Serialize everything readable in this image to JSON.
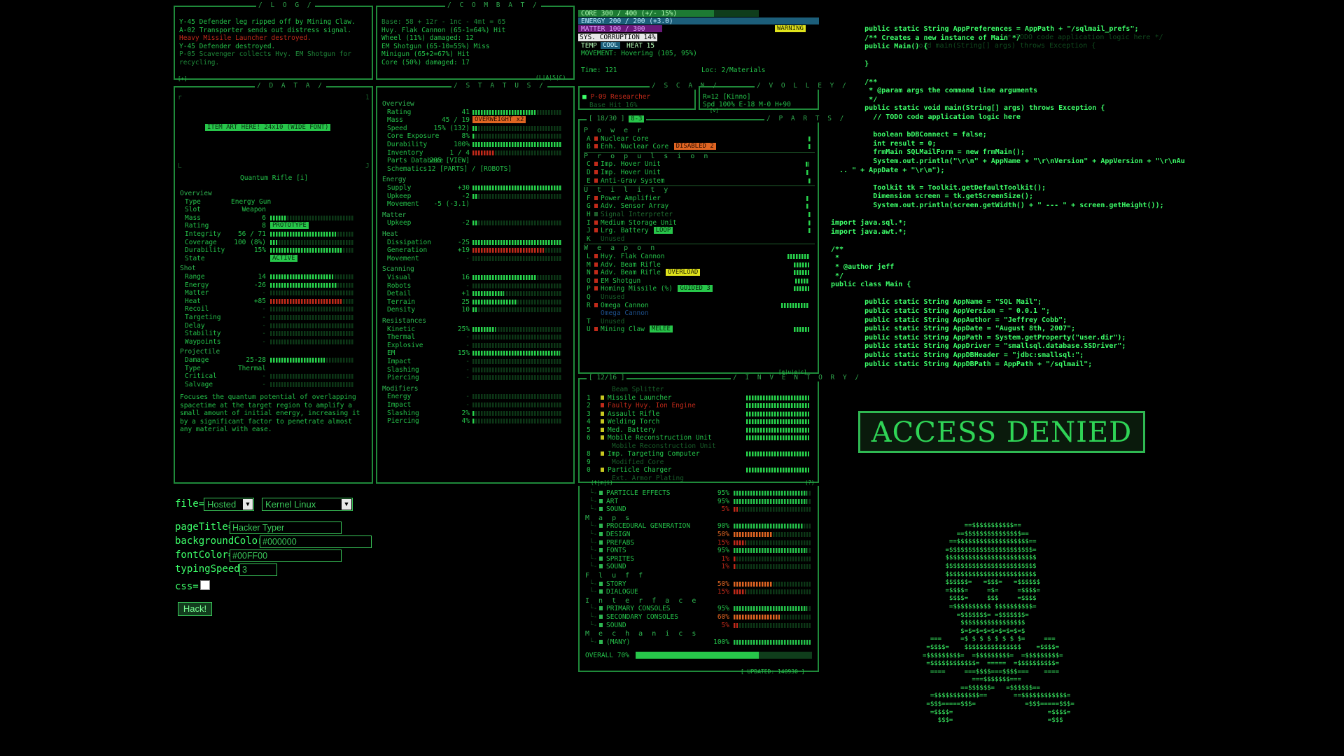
{
  "colors": {
    "accent": "#3dff6a",
    "border": "#1f8a3a",
    "warn": "#e0e31c",
    "danger": "#c22a1a",
    "orange": "#e06522"
  },
  "log": {
    "title": "/ L O G /",
    "lines": [
      "Y-45 Defender leg ripped off by Mining Claw.",
      "A-02 Transporter sends out distress signal.",
      "Heavy Missile Launcher destroyed.",
      "Y-45 Defender destroyed.",
      "P-05 Scavenger collects Hvy. EM Shotgun for",
      "  recycling."
    ],
    "footer_left": "[+]",
    "footer_right": "(L|A|S|C)"
  },
  "combat": {
    "title": "/ C O M B A T /",
    "lines": [
      "Base: 58 + 12r - 1nc - 4mt = 65",
      "Hvy. Flak Cannon (65-1=64%) Hit",
      "  Wheel (11%) damaged: 12",
      "EM Shotgun (65-10=55%) Miss",
      "Minigun (65+2=67%) Hit",
      "  Core (50%) damaged: 17"
    ]
  },
  "vitals": {
    "core": "CORE   300 / 400  (+/- 15%)",
    "energy": "ENERGY 200 / 200  (+3.0)",
    "matter": "MATTER 100 / 300",
    "warning": "WARNING",
    "sys": "SYS. CORRUPTION 14%",
    "temp_label": "TEMP",
    "temp_state": "COOL",
    "heat": "HEAT 15",
    "movement": "MOVEMENT: Hovering (105, 95%)",
    "time": "Time: 121",
    "loc": "Loc: 2/Materials"
  },
  "data_panel": {
    "title": "/ D A T A /",
    "art_placeholder": "ITEM ART HERE! 24x10 (WIDE FONT)",
    "item_name": "Quantum Rifle [i]",
    "sections": [
      {
        "header": "Overview",
        "rows": [
          {
            "label": "Type",
            "value": "Energy Gun"
          },
          {
            "label": "Slot",
            "value": "Weapon"
          },
          {
            "label": "Mass",
            "value": "6",
            "bar": 0.2
          },
          {
            "label": "Rating",
            "value": "8",
            "badge": "PROTOTYPE"
          },
          {
            "label": "Integrity",
            "value": "56 / 71",
            "bar": 0.78
          },
          {
            "label": "Coverage",
            "value": "100 (8%)",
            "bar": 0.08
          },
          {
            "label": "Durability",
            "value": "15%",
            "bar": 0.85
          },
          {
            "label": "State",
            "badge": "ACTIVE"
          }
        ]
      },
      {
        "header": "Shot",
        "rows": [
          {
            "label": "Range",
            "value": "14",
            "bar": 0.75
          },
          {
            "label": "Energy",
            "value": "-26",
            "bar": 0.8
          },
          {
            "label": "Matter",
            "value": "-"
          },
          {
            "label": "Heat",
            "value": "+85",
            "bar": 0.85,
            "red": true
          },
          {
            "label": "Recoil",
            "value": "-"
          },
          {
            "label": "Targeting",
            "value": "-"
          },
          {
            "label": "Delay",
            "value": "-"
          },
          {
            "label": "Stability",
            "value": "-"
          },
          {
            "label": "Waypoints",
            "value": "-"
          }
        ]
      },
      {
        "header": "Projectile",
        "rows": [
          {
            "label": "Damage",
            "value": "25-28",
            "bar": 0.65
          },
          {
            "label": "Type",
            "value": "Thermal"
          },
          {
            "label": "Critical",
            "value": "-"
          },
          {
            "label": "Salvage",
            "value": "-"
          }
        ]
      }
    ],
    "description": [
      "Focuses the quantum potential of overlapping",
      "spacetime at the target region to amplify a",
      "small amount of initial energy, increasing it",
      "by a significant factor to penetrate almost",
      "any material with ease."
    ]
  },
  "status_panel": {
    "title": "/ S T A T U S /",
    "sections": [
      {
        "header": "Overview",
        "rows": [
          {
            "label": "Rating",
            "value": "41",
            "bar": 0.7
          },
          {
            "label": "Mass",
            "value": "45 / 19",
            "badge": "OVERWEIGHT x2"
          },
          {
            "label": "Speed",
            "value": "15% (132)",
            "bar": 0.05
          },
          {
            "label": "Core Exposure",
            "value": "8%",
            "bar": 0.03
          },
          {
            "label": "Durability",
            "value": "100%",
            "bar": 1.0
          },
          {
            "label": "Inventory",
            "value": "1 / 4",
            "bar": 0.25,
            "red": true
          },
          {
            "label": "Parts Database",
            "value": "295 [VIEW]"
          },
          {
            "label": "Schematics",
            "value": "12 [PARTS] / [ROBOTS]"
          }
        ]
      },
      {
        "header": "Energy",
        "rows": [
          {
            "label": "Supply",
            "value": "+30",
            "bar": 1.0
          },
          {
            "label": "Upkeep",
            "value": "-2",
            "bar": 0.06
          },
          {
            "label": "Movement",
            "value": "-5 (-3.1)"
          }
        ]
      },
      {
        "header": "Matter",
        "rows": [
          {
            "label": "Upkeep",
            "value": "-2",
            "bar": 0.06
          }
        ]
      },
      {
        "header": "Heat",
        "rows": [
          {
            "label": "Dissipation",
            "value": "-25",
            "bar": 1.0
          },
          {
            "label": "Generation",
            "value": "+19",
            "bar": 0.8,
            "red": true
          },
          {
            "label": "Movement",
            "value": "-"
          }
        ]
      },
      {
        "header": "Scanning",
        "rows": [
          {
            "label": "Visual",
            "value": "16",
            "bar": 0.72
          },
          {
            "label": "Robots",
            "value": "-"
          },
          {
            "label": "Detail",
            "value": "+1",
            "bar": 0.35
          },
          {
            "label": "Terrain",
            "value": "25",
            "bar": 0.5
          },
          {
            "label": "Density",
            "value": "10",
            "bar": 0.05
          }
        ]
      },
      {
        "header": "Resistances",
        "rows": [
          {
            "label": "Kinetic",
            "value": "25%",
            "bar": 0.26
          },
          {
            "label": "Thermal",
            "value": "-"
          },
          {
            "label": "Explosive",
            "value": "-"
          },
          {
            "label": "EM",
            "value": "15%",
            "bar": 0.98
          },
          {
            "label": "Impact",
            "value": "-"
          },
          {
            "label": "Slashing",
            "value": "-"
          },
          {
            "label": "Piercing",
            "value": "-"
          }
        ]
      },
      {
        "header": "Modifiers",
        "rows": [
          {
            "label": "Energy",
            "value": "-"
          },
          {
            "label": "Impact",
            "value": "-"
          },
          {
            "label": "Slashing",
            "value": "2%",
            "bar": 0.02
          },
          {
            "label": "Piercing",
            "value": "4%",
            "bar": 0.03
          }
        ]
      }
    ]
  },
  "scan": {
    "title": "/ S C A N /",
    "line1": "P-09 Researcher",
    "line2": "Base Hit 16%"
  },
  "volley": {
    "title": "/ V O L L E Y /",
    "line1": "R=12 [Kinno]",
    "line2": "Spd 100% E-18 M-0 H+90",
    "footer": "[v]"
  },
  "parts": {
    "title": "/ P A R T S /",
    "counter": "[ 18/30 ]",
    "counter_badge": "8-3",
    "groups": [
      {
        "header": "P o w e r",
        "items": [
          {
            "key": "A",
            "name": "Nuclear Core",
            "strength": 0.01
          },
          {
            "key": "B",
            "name": "Enh. Nuclear Core",
            "badge": "DISABLED 2",
            "badge_color": "orange",
            "strength": 0.01
          }
        ]
      },
      {
        "header": "P r o p u l s i o n",
        "items": [
          {
            "key": "C",
            "name": "Imp. Hover Unit",
            "strength": 0.06
          },
          {
            "key": "D",
            "name": "Imp. Hover Unit",
            "strength": 0.04
          },
          {
            "key": "E",
            "name": "Anti-Grav System",
            "strength": 0.01
          }
        ]
      },
      {
        "header": "U t i l i t y",
        "items": [
          {
            "key": "F",
            "name": "Power Amplifier",
            "strength": 0.04
          },
          {
            "key": "G",
            "name": "Adv. Sensor Array",
            "strength": 0.04
          },
          {
            "key": "H",
            "name": "Signal Interpreter",
            "dim": true,
            "strength": 0.01
          },
          {
            "key": "I",
            "name": "Medium Storage Unit",
            "strength": 0.01
          },
          {
            "key": "J",
            "name": "Lrg. Battery",
            "badge": "LOOP",
            "badge_color": "lime",
            "strength": 0.01
          },
          {
            "key": "K",
            "name": "Unused",
            "dim": true,
            "unused": true
          }
        ]
      },
      {
        "header": "W e a p o n",
        "items": [
          {
            "key": "L",
            "name": "Hvy. Flak Cannon",
            "strength": 0.35
          },
          {
            "key": "M",
            "name": "Adv. Beam Rifle",
            "strength": 0.25
          },
          {
            "key": "N",
            "name": "Adv. Beam Rifle",
            "badge": "OVERLOAD",
            "badge_color": "yellow",
            "strength": 0.25
          },
          {
            "key": "O",
            "name": "EM Shotgun",
            "strength": 0.22
          },
          {
            "key": "P",
            "name": "Homing Missile (%)",
            "badge": "GUIDED 3",
            "badge_color": "lime",
            "strength": 0.25
          },
          {
            "key": "Q",
            "name": "Unused",
            "dim": true,
            "unused": true
          },
          {
            "key": "R",
            "name": "Omega Cannon",
            "strength": 0.45
          },
          {
            "key": "",
            "name": "Omega Cannon",
            "dim": true,
            "unused": true
          },
          {
            "key": "T",
            "name": "Unused",
            "dim": true,
            "unused": true
          },
          {
            "key": "U",
            "name": "Mining Claw",
            "badge": "MELEE",
            "badge_color": "lime",
            "strength": 0.25
          }
        ]
      }
    ],
    "footer": "[q|u|e|c]"
  },
  "inventory": {
    "title": "/ I N V E N T O R Y /",
    "counter": "[ 12/16 ]",
    "items": [
      {
        "key": "",
        "name": "Beam Splitter",
        "dim": true
      },
      {
        "key": "1",
        "name": "Missile Launcher",
        "strength": 0.5
      },
      {
        "key": "2",
        "name": "Faulty Hvy. Ion Engine",
        "red": true,
        "strength": 0.5
      },
      {
        "key": "3",
        "name": "Assault Rifle",
        "strength": 0.5
      },
      {
        "key": "4",
        "name": "Welding Torch",
        "strength": 0.5
      },
      {
        "key": "5",
        "name": "Med. Battery",
        "strength": 0.5
      },
      {
        "key": "6",
        "name": "Mobile Reconstruction Unit",
        "strength": 0.5
      },
      {
        "key": "",
        "name": "Mobile Reconstruction Unit",
        "dim": true
      },
      {
        "key": "8",
        "name": "Imp. Targeting Computer",
        "strength": 0.5
      },
      {
        "key": "9",
        "name": "Modified Core",
        "dim": true
      },
      {
        "key": "0",
        "name": "Particle Charger",
        "strength": 0.5
      },
      {
        "key": "",
        "name": "Ext. Armor Plating",
        "dim": true
      }
    ],
    "footer_left": "(t|m|i)",
    "footer_right": "(?)"
  },
  "progress": {
    "sections": [
      {
        "header": "",
        "items": [
          {
            "name": "PARTICLE EFFECTS",
            "value": "95%"
          },
          {
            "name": "ART",
            "value": "95%"
          },
          {
            "name": "SOUND",
            "value": "5%",
            "red": true
          }
        ]
      },
      {
        "header": "M a p s",
        "items": [
          {
            "name": "PROCEDURAL GENERATION",
            "value": "90%"
          },
          {
            "name": "DESIGN",
            "value": "50%",
            "orange": true
          },
          {
            "name": "PREFABS",
            "value": "15%",
            "red": true
          },
          {
            "name": "FONTS",
            "value": "95%"
          },
          {
            "name": "SPRITES",
            "value": "1%",
            "red": true
          },
          {
            "name": "SOUND",
            "value": "1%",
            "red": true
          }
        ]
      },
      {
        "header": "F l u f f",
        "items": [
          {
            "name": "STORY",
            "value": "50%",
            "orange": true
          },
          {
            "name": "DIALOGUE",
            "value": "15%",
            "red": true
          }
        ]
      },
      {
        "header": "I n t e r f a c e",
        "items": [
          {
            "name": "PRIMARY CONSOLES",
            "value": "95%"
          },
          {
            "name": "SECONDARY CONSOLES",
            "value": "60%",
            "orange": true
          },
          {
            "name": "SOUND",
            "value": "5%",
            "red": true
          }
        ]
      },
      {
        "header": "M e c h a n i c s",
        "items": [
          {
            "name": "(MANY)",
            "value": "100%"
          }
        ]
      }
    ],
    "overall_label": "OVERALL",
    "overall_value": "70%",
    "updated": "[ UPDATED: 140930 ]"
  },
  "form": {
    "file_label": "file=",
    "file_select": "Hosted",
    "kernel_select": "Kernel Linux",
    "page_title_label": "pageTitle=",
    "page_title_value": "Hacker Typer",
    "bg_label": "backgroundColor=",
    "bg_value": "#000000",
    "font_label": "fontColor=",
    "font_value": "#00FF00",
    "speed_label": "typingSpeed=",
    "speed_value": "3",
    "css_label": "css=",
    "hack_button": "Hack!"
  },
  "code": {
    "lines": [
      "        public static String AppPreferences = AppPath + \"/sqlmail_prefs\";",
      "        /** Creates a new instance of Main */",
      "        public Main() {",
      "",
      "        }",
      "",
      "        /**",
      "         * @param args the command line arguments",
      "         */",
      "        public static void main(String[] args) throws Exception {",
      "          // TODO code application logic here",
      "",
      "          boolean bDBConnect = false;",
      "          int result = 0;",
      "          frmMain SQLMailForm = new frmMain();",
      "          System.out.println(\"\\r\\n\" + AppName + \"\\r\\nVersion\" + AppVersion + \"\\r\\nAu",
      "  .. \" + AppDate + \"\\r\\n\");",
      "",
      "          Toolkit tk = Toolkit.getDefaultToolkit();",
      "          Dimension screen = tk.getScreenSize();",
      "          System.out.println(screen.getWidth() + \" --- \" + screen.getHeight());",
      "",
      "import java.sql.*;",
      "import java.awt.*;",
      "",
      "/**",
      " *",
      " * @author jeff",
      " */",
      "public class Main {",
      "",
      "        public static String AppName = \"SQL Mail\";",
      "        public static String AppVersion = \" 0.0.1 \";",
      "        public static String AppAuthor = \"Jeffrey Cobb\";",
      "        public static String AppDate = \"August 8th, 2007\";",
      "        public static String AppPath = System.getProperty(\"user.dir\");",
      "        public static String AppDriver = \"smallsql.database.SSDriver\";",
      "        public static String AppDBHeader = \"jdbc:smallsql:\";",
      "        public static String AppDBPath = AppPath + \"/sqlmail\";"
    ]
  },
  "access_denied": "ACCESS DENIED",
  "skull": [
    "           ==$$$$$$$$$$$==",
    "         ==$$$$$$$$$$$$$$$==",
    "       ==$$$$$$$$$$$$$$$$$$$==",
    "      =$$$$$$$$$$$$$$$$$$$$$$=",
    "      $$$$$$$$$$$$$$$$$$$$$$$$",
    "      $$$$$$$$$$$$$$$$$$$$$$$$",
    "      $$$$$$$$$$$$$$$$$$$$$$$$",
    "      $$$$$$=   =$$$=   =$$$$$$",
    "      =$$$$=     =$=     =$$$$=",
    "       $$$$=     $$$     =$$$$",
    "       =$$$$$$$$$$ $$$$$$$$$$=",
    "         =$$$$$$$= =$$$$$$$=",
    "          $$$$$$$$$$$$$$$$$",
    "          $=$=$=$=$=$=$=$=$",
    "  ===     =$ $ $ $ $ $ $ $=     ===",
    " =$$$$=    $$$$$$$$$$$$$$$    =$$$$=",
    "=$$$$$$$$$=  =$$$$$$$$$=  =$$$$$$$$$=",
    " =$$$$$$$$$$$$=  =====  =$$$$$$$$$$=",
    "  ====     ===$$$$===$$$$===    ====",
    "             ===$$$$$$$===",
    "          ==$$$$$$=   =$$$$$$==",
    "  =$$$$$$$$$$$$==       ==$$$$$$$$$$$$=",
    " =$$$=====$$$=             =$$$=====$$$=",
    "  =$$$$=                         =$$$$=",
    "    $$$=                         =$$$"
  ]
}
